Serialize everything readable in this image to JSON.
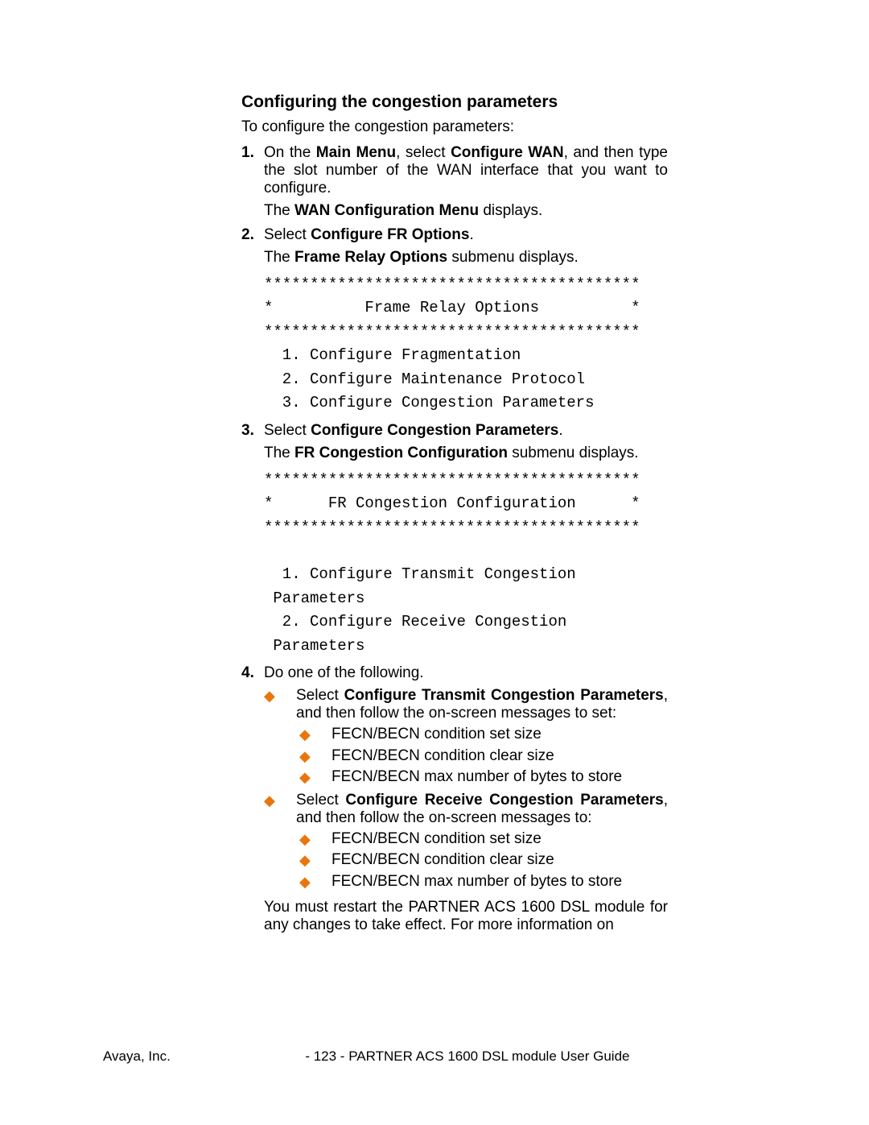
{
  "heading": "Configuring the congestion parameters",
  "intro": "To configure the congestion parameters:",
  "steps": {
    "s1": {
      "num": "1.",
      "text_a": "On the ",
      "bold_a": "Main Menu",
      "text_b": ", select ",
      "bold_b": "Configure WAN",
      "text_c": ", and then type the slot number of the WAN interface that you want to configure.",
      "sub_a": "The ",
      "sub_bold": "WAN Configuration Menu",
      "sub_b": " displays."
    },
    "s2": {
      "num": "2.",
      "text_a": "Select ",
      "bold_a": "Configure FR Options",
      "text_b": ".",
      "sub_a": "The ",
      "sub_bold": "Frame Relay Options",
      "sub_b": " submenu displays."
    },
    "mono1": "*****************************************\n*          Frame Relay Options          *\n*****************************************\n  1. Configure Fragmentation\n  2. Configure Maintenance Protocol\n  3. Configure Congestion Parameters",
    "s3": {
      "num": "3.",
      "text_a": "Select ",
      "bold_a": "Configure Congestion Parameters",
      "text_b": ".",
      "sub_a": "The ",
      "sub_bold": "FR Congestion Configuration",
      "sub_b": " submenu displays."
    },
    "mono2": "*****************************************\n*      FR Congestion Configuration      *\n*****************************************\n\n  1. Configure Transmit Congestion\n Parameters\n  2. Configure Receive Congestion\n Parameters",
    "s4": {
      "num": "4.",
      "text": "Do one of the following.",
      "bullets": {
        "b1": {
          "pre": "Select ",
          "bold": "Configure Transmit Congestion Parameters",
          "post": ", and then follow the on-screen messages to set:",
          "subs": {
            "a": "FECN/BECN condition set size",
            "b": "FECN/BECN condition clear size",
            "c": "FECN/BECN max number of bytes to store"
          }
        },
        "b2": {
          "pre": "Select ",
          "bold": "Configure Receive Congestion Parameters",
          "post": ", and then follow the on-screen messages to:",
          "subs": {
            "a": "FECN/BECN condition set size",
            "b": "FECN/BECN condition clear size",
            "c": "FECN/BECN max number of bytes to store"
          }
        }
      }
    }
  },
  "closing": "You must restart the PARTNER ACS 1600 DSL module for any changes to take effect.  For more information on",
  "footer": {
    "left": "Avaya, Inc.",
    "center": "- 123 -",
    "right": "PARTNER ACS 1600 DSL module User Guide"
  }
}
